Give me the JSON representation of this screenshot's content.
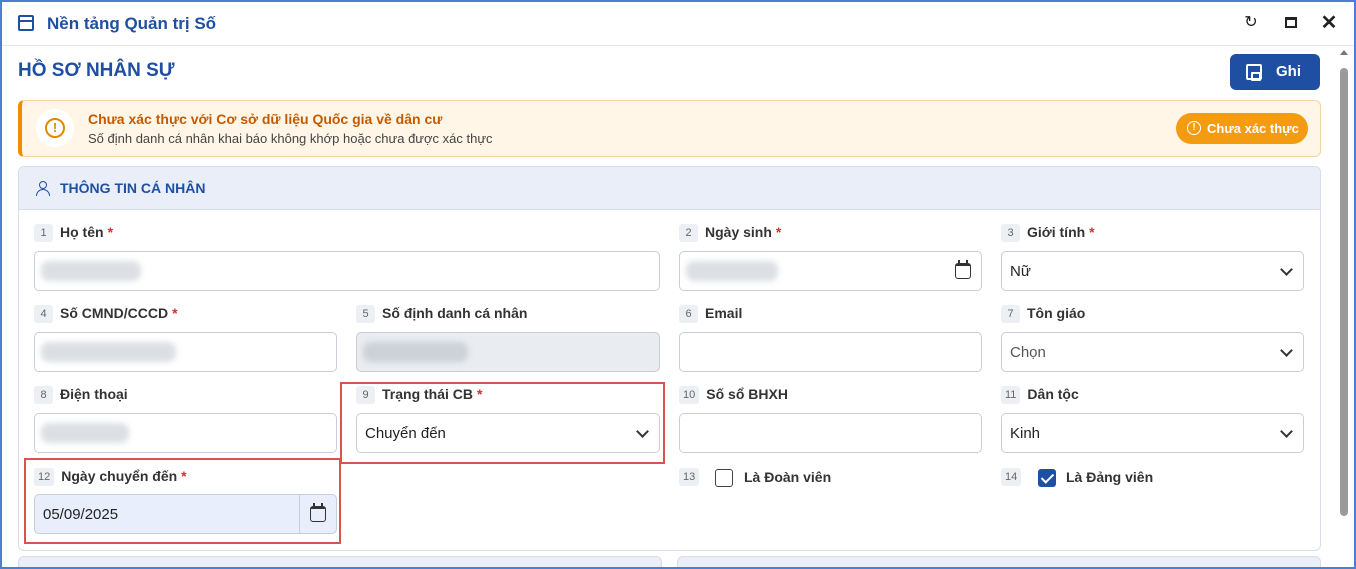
{
  "window": {
    "title": "Nền tảng Quản trị Số"
  },
  "page": {
    "title": "HỒ SƠ NHÂN SỰ",
    "save_label": "Ghi"
  },
  "alert": {
    "title": "Chưa xác thực với Cơ sở dữ liệu Quốc gia về dân cư",
    "description": "Số định danh cá nhân khai báo không khớp hoặc chưa được xác thực",
    "button_label": "Chưa xác thực",
    "icon_glyph": "!"
  },
  "section": {
    "title": "THÔNG TIN CÁ NHÂN"
  },
  "fields": {
    "ho_ten": {
      "num": "1",
      "label": "Họ tên",
      "required": "*"
    },
    "ngay_sinh": {
      "num": "2",
      "label": "Ngày sinh",
      "required": "*"
    },
    "gioi_tinh": {
      "num": "3",
      "label": "Giới tính",
      "required": "*",
      "value": "Nữ"
    },
    "cmnd": {
      "num": "4",
      "label": "Số CMND/CCCD",
      "required": "*"
    },
    "dinh_danh": {
      "num": "5",
      "label": "Số định danh cá nhân"
    },
    "email": {
      "num": "6",
      "label": "Email"
    },
    "ton_giao": {
      "num": "7",
      "label": "Tôn giáo",
      "value": "Chọn"
    },
    "dien_thoai": {
      "num": "8",
      "label": "Điện thoại"
    },
    "trang_thai": {
      "num": "9",
      "label": "Trạng thái CB",
      "required": "*",
      "value": "Chuyển đến"
    },
    "so_bhxh": {
      "num": "10",
      "label": "Số sổ BHXH"
    },
    "dan_toc": {
      "num": "11",
      "label": "Dân tộc",
      "value": "Kinh"
    },
    "ngay_chuyen_den": {
      "num": "12",
      "label": "Ngày chuyển đến",
      "required": "*",
      "value": "05/09/2025"
    },
    "doan_vien": {
      "num": "13",
      "label": "Là Đoàn viên",
      "checked": false
    },
    "dang_vien": {
      "num": "14",
      "label": "Là Đảng viên",
      "checked": true
    }
  },
  "colors": {
    "brand": "#1f4fa3",
    "warning": "#f39c12",
    "highlight": "#d9534f"
  }
}
